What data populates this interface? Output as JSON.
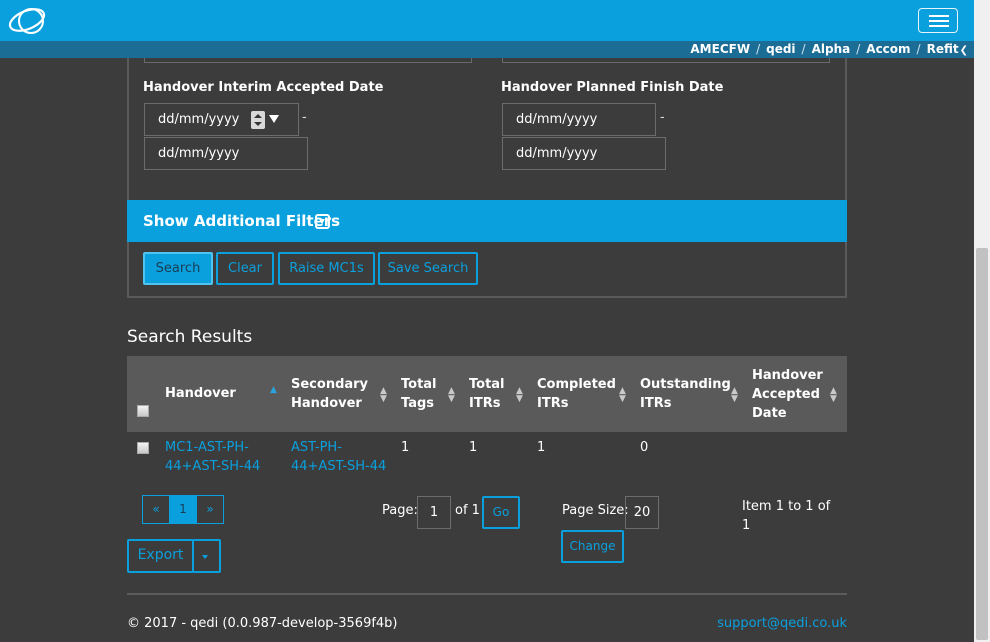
{
  "breadcrumb": [
    "AMECFW",
    "qedi",
    "Alpha",
    "Accom",
    "Refit"
  ],
  "filters": {
    "interim_label": "Handover Interim Accepted Date",
    "planned_label": "Handover Planned Finish Date",
    "date_placeholder": "dd/mm/yyyy",
    "range_separator": "-"
  },
  "additional_filters_label": "Show Additional Filters",
  "actions": {
    "search": "Search",
    "clear": "Clear",
    "raise": "Raise MC1s",
    "save": "Save Search"
  },
  "results": {
    "title": "Search Results",
    "columns": [
      {
        "line1": "Handover",
        "line2": ""
      },
      {
        "line1": "Secondary",
        "line2": "Handover"
      },
      {
        "line1": "Total",
        "line2": "Tags"
      },
      {
        "line1": "Total",
        "line2": "ITRs"
      },
      {
        "line1": "Completed",
        "line2": "ITRs"
      },
      {
        "line1": "Outstanding",
        "line2": "ITRs"
      },
      {
        "line1": "Handover",
        "line2": "Accepted",
        "line3": "Date"
      }
    ],
    "rows": [
      {
        "handover_l1": "MC1-AST-PH-",
        "handover_l2": "44+AST-SH-44",
        "secondary_l1": "AST-PH-",
        "secondary_l2": "44+AST-SH-44",
        "total_tags": "1",
        "total_itrs": "1",
        "completed_itrs": "1",
        "outstanding_itrs": "0",
        "accepted_date": ""
      }
    ]
  },
  "pagination": {
    "prev": "«",
    "current": "1",
    "next": "»",
    "page_label": "Page:",
    "page_value": "1",
    "of_label": "of 1",
    "go": "Go",
    "size_label": "Page Size:",
    "size_value": "20",
    "change": "Change",
    "item_l1": "Item 1 to 1 of",
    "item_l2": "1"
  },
  "export_label": "Export",
  "footer": {
    "copyright": "© 2017 - qedi (0.0.987-develop-3569f4b)",
    "support": "support@qedi.co.uk"
  }
}
